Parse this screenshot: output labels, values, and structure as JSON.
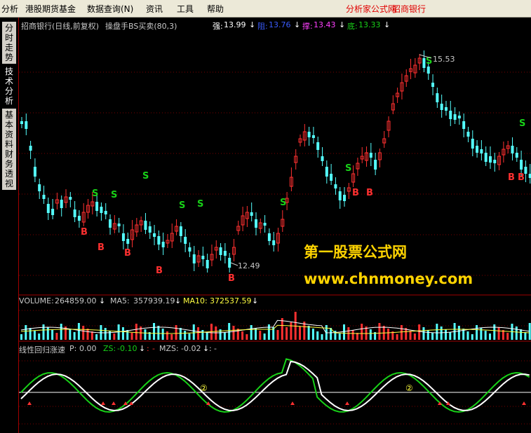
{
  "menu": {
    "items": [
      "分析",
      "港股期货基金",
      "数据查询(N)",
      "资讯",
      "工具",
      "帮助"
    ],
    "brand_site": "分析家公式网",
    "brand_stock": "招商银行"
  },
  "side_tabs": [
    {
      "label": "分时走势",
      "active": false
    },
    {
      "label": "技术分析",
      "active": true
    },
    {
      "label": "基本资料",
      "active": false
    },
    {
      "label": "财务透视",
      "active": false
    }
  ],
  "main_panel": {
    "title": "招商银行(日线,前复权)",
    "indicator": "操盘手BS买卖(80,3)",
    "strong_label": "强:",
    "strong_value": "13.99",
    "resist_label": "阻:",
    "resist_value": "13.76",
    "support_label": "撑:",
    "support_value": "13.43",
    "bottom_label": "底:",
    "bottom_value": "13.33",
    "high_marker": "15.53",
    "low_marker": "12.49",
    "signal_buy": "B",
    "signal_sell": "S"
  },
  "volume_panel": {
    "volume_label": "VOLUME:",
    "volume_value": "264859.00",
    "ma5_label": "MA5:",
    "ma5_value": "357939.19",
    "ma10_label": "MA10:",
    "ma10_value": "372537.59"
  },
  "osc_panel": {
    "title": "线性回归涨速",
    "p_label": "P:",
    "p_value": "0.00",
    "zs_label": "ZS:",
    "zs_value": "-0.10",
    "mzs_label": "MZS:",
    "mzs_value": "-0.02",
    "mark": "②"
  },
  "watermark": {
    "line1": "第一股票公式网",
    "line2": "www.chnmoney.com"
  },
  "colors": {
    "up": "#ff3030",
    "down": "#54ffff",
    "buy": "#ff3030",
    "sell": "#18d018",
    "grid": "#7a0000",
    "volume_line": "#ffffff",
    "zs_line": "#ffffff",
    "watermark": "#ffd400"
  }
}
